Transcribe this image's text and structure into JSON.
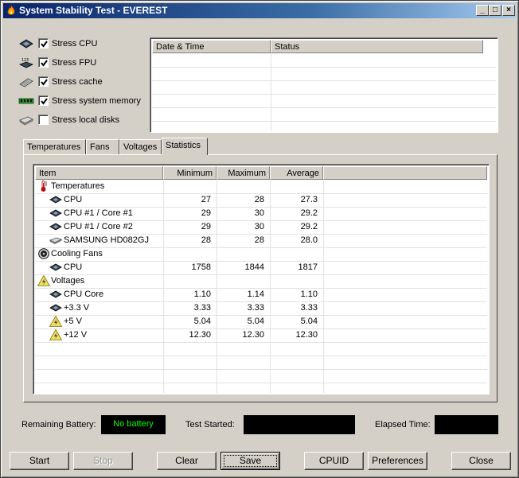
{
  "window": {
    "title": "System Stability Test - EVEREST",
    "controls": {
      "minimize": "_",
      "maximize": "□",
      "close": "×"
    }
  },
  "stress_options": [
    {
      "label": "Stress CPU",
      "checked": true,
      "icon": "cpu-chip-icon"
    },
    {
      "label": "Stress FPU",
      "checked": true,
      "icon": "fpu-icon"
    },
    {
      "label": "Stress cache",
      "checked": true,
      "icon": "cache-icon"
    },
    {
      "label": "Stress system memory",
      "checked": true,
      "icon": "memory-icon"
    },
    {
      "label": "Stress local disks",
      "checked": false,
      "icon": "disk-icon"
    }
  ],
  "log": {
    "columns": [
      "Date & Time",
      "Status"
    ]
  },
  "tabs": [
    "Temperatures",
    "Fans",
    "Voltages",
    "Statistics"
  ],
  "active_tab": "Statistics",
  "statistics": {
    "columns": [
      "Item",
      "Minimum",
      "Maximum",
      "Average"
    ],
    "rows": [
      {
        "type": "group",
        "item": "Temperatures",
        "icon": "thermometer-icon"
      },
      {
        "type": "item",
        "item": "CPU",
        "min": "27",
        "max": "28",
        "avg": "27.3",
        "icon": "cpu-chip-icon"
      },
      {
        "type": "item",
        "item": "CPU #1 / Core #1",
        "min": "29",
        "max": "30",
        "avg": "29.2",
        "icon": "cpu-chip-icon"
      },
      {
        "type": "item",
        "item": "CPU #1 / Core #2",
        "min": "29",
        "max": "30",
        "avg": "29.2",
        "icon": "cpu-chip-icon"
      },
      {
        "type": "item",
        "item": "SAMSUNG HD082GJ",
        "min": "28",
        "max": "28",
        "avg": "28.0",
        "icon": "disk-icon"
      },
      {
        "type": "group",
        "item": "Cooling Fans",
        "icon": "fan-icon"
      },
      {
        "type": "item",
        "item": "CPU",
        "min": "1758",
        "max": "1844",
        "avg": "1817",
        "icon": "cpu-chip-icon"
      },
      {
        "type": "group",
        "item": "Voltages",
        "icon": "voltage-icon"
      },
      {
        "type": "item",
        "item": "CPU Core",
        "min": "1.10",
        "max": "1.14",
        "avg": "1.10",
        "icon": "cpu-chip-icon"
      },
      {
        "type": "item",
        "item": "+3.3 V",
        "min": "3.33",
        "max": "3.33",
        "avg": "3.33",
        "icon": "cpu-chip-icon"
      },
      {
        "type": "item",
        "item": "+5 V",
        "min": "5.04",
        "max": "5.04",
        "avg": "5.04",
        "icon": "voltage-icon"
      },
      {
        "type": "item",
        "item": "+12 V",
        "min": "12.30",
        "max": "12.30",
        "avg": "12.30",
        "icon": "voltage-icon"
      }
    ]
  },
  "status": {
    "battery_label": "Remaining Battery:",
    "battery_value": "No battery",
    "started_label": "Test Started:",
    "started_value": "",
    "elapsed_label": "Elapsed Time:",
    "elapsed_value": ""
  },
  "buttons": {
    "start": "Start",
    "stop": "Stop",
    "clear": "Clear",
    "save": "Save",
    "cpuid": "CPUID",
    "preferences": "Preferences",
    "close": "Close"
  },
  "colors": {
    "title_gradient_start": "#0a246a",
    "title_gradient_end": "#a6caf0",
    "face": "#d4d0c8",
    "battery_text": "#00ff00"
  }
}
